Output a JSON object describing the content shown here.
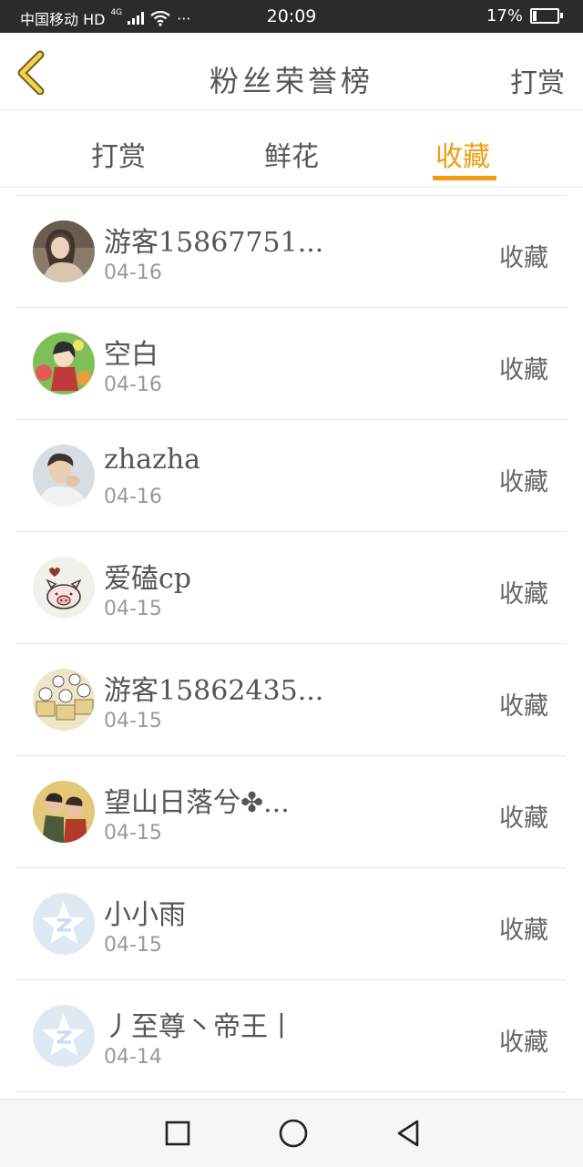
{
  "status_bar": {
    "carrier": "中国移动 HD",
    "network": "4G",
    "more": "···",
    "time": "20:09",
    "battery": "17%",
    "battery_level": 0.17
  },
  "header": {
    "title": "粉丝荣誉榜",
    "action": "打赏",
    "accent_color": "#f39c12"
  },
  "tabs": [
    {
      "label": "打赏",
      "active": false
    },
    {
      "label": "鲜花",
      "active": false
    },
    {
      "label": "收藏",
      "active": true
    }
  ],
  "list": [
    {
      "name": "游客15867751...",
      "date": "04-16",
      "action": "收藏",
      "avatar": "photo-girl"
    },
    {
      "name": "空白",
      "date": "04-16",
      "action": "收藏",
      "avatar": "anime-flowers"
    },
    {
      "name": "zhazha",
      "date": "04-16",
      "action": "收藏",
      "avatar": "photo-boy"
    },
    {
      "name": "爱磕cp",
      "date": "04-15",
      "action": "收藏",
      "avatar": "pig-cartoon"
    },
    {
      "name": "游客15862435...",
      "date": "04-15",
      "action": "收藏",
      "avatar": "cats-boxes"
    },
    {
      "name": "望山日落兮✤...",
      "date": "04-15",
      "action": "收藏",
      "avatar": "cartoon-kids"
    },
    {
      "name": "小小雨",
      "date": "04-15",
      "action": "收藏",
      "avatar": "default-star"
    },
    {
      "name": "丿至尊丶帝王丨",
      "date": "04-14",
      "action": "收藏",
      "avatar": "default-star"
    }
  ],
  "nav": {
    "recents": "square-icon",
    "home": "circle-icon",
    "back": "triangle-back-icon"
  }
}
